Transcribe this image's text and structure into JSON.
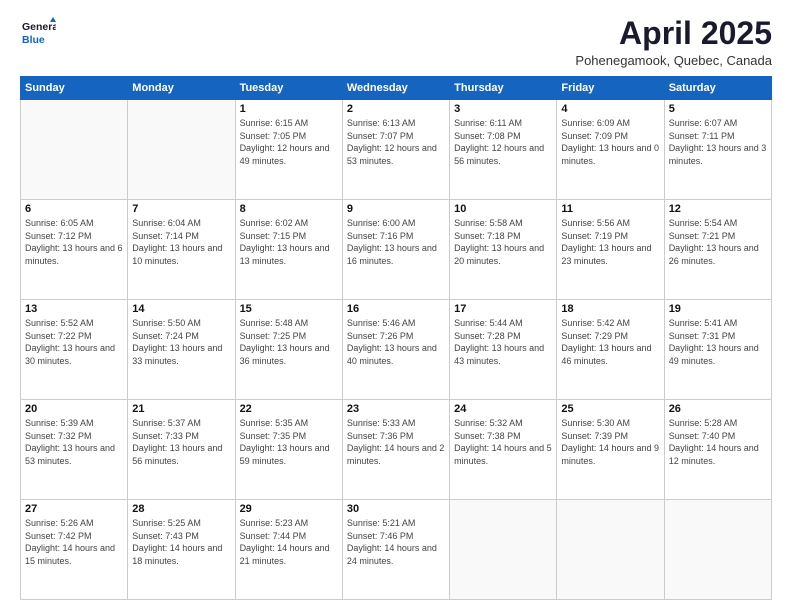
{
  "logo": {
    "line1": "General",
    "line2": "Blue"
  },
  "title": "April 2025",
  "subtitle": "Pohenegamook, Quebec, Canada",
  "days_of_week": [
    "Sunday",
    "Monday",
    "Tuesday",
    "Wednesday",
    "Thursday",
    "Friday",
    "Saturday"
  ],
  "weeks": [
    [
      {
        "day": "",
        "info": ""
      },
      {
        "day": "",
        "info": ""
      },
      {
        "day": "1",
        "info": "Sunrise: 6:15 AM\nSunset: 7:05 PM\nDaylight: 12 hours and 49 minutes."
      },
      {
        "day": "2",
        "info": "Sunrise: 6:13 AM\nSunset: 7:07 PM\nDaylight: 12 hours and 53 minutes."
      },
      {
        "day": "3",
        "info": "Sunrise: 6:11 AM\nSunset: 7:08 PM\nDaylight: 12 hours and 56 minutes."
      },
      {
        "day": "4",
        "info": "Sunrise: 6:09 AM\nSunset: 7:09 PM\nDaylight: 13 hours and 0 minutes."
      },
      {
        "day": "5",
        "info": "Sunrise: 6:07 AM\nSunset: 7:11 PM\nDaylight: 13 hours and 3 minutes."
      }
    ],
    [
      {
        "day": "6",
        "info": "Sunrise: 6:05 AM\nSunset: 7:12 PM\nDaylight: 13 hours and 6 minutes."
      },
      {
        "day": "7",
        "info": "Sunrise: 6:04 AM\nSunset: 7:14 PM\nDaylight: 13 hours and 10 minutes."
      },
      {
        "day": "8",
        "info": "Sunrise: 6:02 AM\nSunset: 7:15 PM\nDaylight: 13 hours and 13 minutes."
      },
      {
        "day": "9",
        "info": "Sunrise: 6:00 AM\nSunset: 7:16 PM\nDaylight: 13 hours and 16 minutes."
      },
      {
        "day": "10",
        "info": "Sunrise: 5:58 AM\nSunset: 7:18 PM\nDaylight: 13 hours and 20 minutes."
      },
      {
        "day": "11",
        "info": "Sunrise: 5:56 AM\nSunset: 7:19 PM\nDaylight: 13 hours and 23 minutes."
      },
      {
        "day": "12",
        "info": "Sunrise: 5:54 AM\nSunset: 7:21 PM\nDaylight: 13 hours and 26 minutes."
      }
    ],
    [
      {
        "day": "13",
        "info": "Sunrise: 5:52 AM\nSunset: 7:22 PM\nDaylight: 13 hours and 30 minutes."
      },
      {
        "day": "14",
        "info": "Sunrise: 5:50 AM\nSunset: 7:24 PM\nDaylight: 13 hours and 33 minutes."
      },
      {
        "day": "15",
        "info": "Sunrise: 5:48 AM\nSunset: 7:25 PM\nDaylight: 13 hours and 36 minutes."
      },
      {
        "day": "16",
        "info": "Sunrise: 5:46 AM\nSunset: 7:26 PM\nDaylight: 13 hours and 40 minutes."
      },
      {
        "day": "17",
        "info": "Sunrise: 5:44 AM\nSunset: 7:28 PM\nDaylight: 13 hours and 43 minutes."
      },
      {
        "day": "18",
        "info": "Sunrise: 5:42 AM\nSunset: 7:29 PM\nDaylight: 13 hours and 46 minutes."
      },
      {
        "day": "19",
        "info": "Sunrise: 5:41 AM\nSunset: 7:31 PM\nDaylight: 13 hours and 49 minutes."
      }
    ],
    [
      {
        "day": "20",
        "info": "Sunrise: 5:39 AM\nSunset: 7:32 PM\nDaylight: 13 hours and 53 minutes."
      },
      {
        "day": "21",
        "info": "Sunrise: 5:37 AM\nSunset: 7:33 PM\nDaylight: 13 hours and 56 minutes."
      },
      {
        "day": "22",
        "info": "Sunrise: 5:35 AM\nSunset: 7:35 PM\nDaylight: 13 hours and 59 minutes."
      },
      {
        "day": "23",
        "info": "Sunrise: 5:33 AM\nSunset: 7:36 PM\nDaylight: 14 hours and 2 minutes."
      },
      {
        "day": "24",
        "info": "Sunrise: 5:32 AM\nSunset: 7:38 PM\nDaylight: 14 hours and 5 minutes."
      },
      {
        "day": "25",
        "info": "Sunrise: 5:30 AM\nSunset: 7:39 PM\nDaylight: 14 hours and 9 minutes."
      },
      {
        "day": "26",
        "info": "Sunrise: 5:28 AM\nSunset: 7:40 PM\nDaylight: 14 hours and 12 minutes."
      }
    ],
    [
      {
        "day": "27",
        "info": "Sunrise: 5:26 AM\nSunset: 7:42 PM\nDaylight: 14 hours and 15 minutes."
      },
      {
        "day": "28",
        "info": "Sunrise: 5:25 AM\nSunset: 7:43 PM\nDaylight: 14 hours and 18 minutes."
      },
      {
        "day": "29",
        "info": "Sunrise: 5:23 AM\nSunset: 7:44 PM\nDaylight: 14 hours and 21 minutes."
      },
      {
        "day": "30",
        "info": "Sunrise: 5:21 AM\nSunset: 7:46 PM\nDaylight: 14 hours and 24 minutes."
      },
      {
        "day": "",
        "info": ""
      },
      {
        "day": "",
        "info": ""
      },
      {
        "day": "",
        "info": ""
      }
    ]
  ]
}
